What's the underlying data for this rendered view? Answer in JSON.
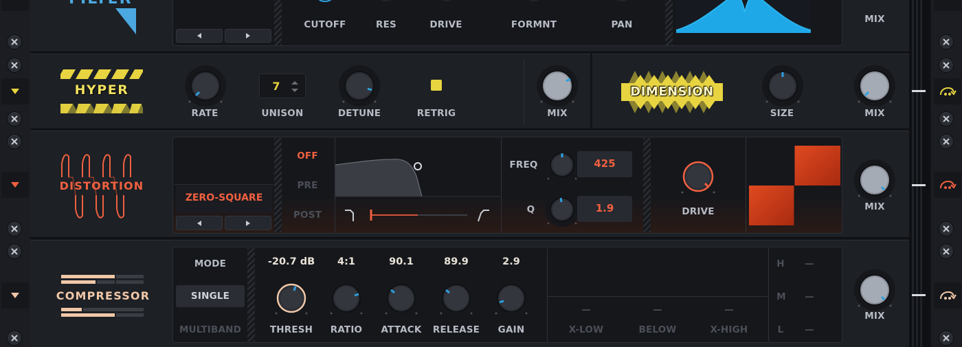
{
  "filter": {
    "title": "FILTER",
    "knob_labels": [
      "CUTOFF",
      "RES",
      "DRIVE",
      "FORMNT",
      "PAN"
    ],
    "mix_label": "MIX"
  },
  "hyper": {
    "logo": "HYPER",
    "rate_label": "RATE",
    "unison_label": "UNISON",
    "unison_value": "7",
    "detune_label": "DETUNE",
    "retrig_label": "RETRIG",
    "mix_label": "MIX",
    "accent": "#e8d440"
  },
  "dimension": {
    "logo": "DIMENSION",
    "size_label": "SIZE",
    "mix_label": "MIX"
  },
  "distortion": {
    "logo": "DISTORTION",
    "type": "ZERO-SQUARE",
    "filter_modes": [
      "OFF",
      "PRE",
      "POST"
    ],
    "freq_label": "FREQ",
    "freq_value": "425",
    "q_label": "Q",
    "q_value": "1.9",
    "drive_label": "DRIVE",
    "mix_label": "MIX",
    "accent": "#f06040"
  },
  "compressor": {
    "logo": "COMPRESSOR",
    "mode_label": "MODE",
    "modes": [
      "SINGLE",
      "MULTIBAND"
    ],
    "values": [
      "-20.7 dB",
      "4:1",
      "90.1",
      "89.9",
      "2.9"
    ],
    "knob_labels": [
      "THRESH",
      "RATIO",
      "ATTACK",
      "RELEASE",
      "GAIN"
    ],
    "band_labels": [
      "X-LOW",
      "BELOW",
      "X-HIGH"
    ],
    "band_values": [
      "—",
      "—",
      "—"
    ],
    "meter_labels": [
      "H",
      "M",
      "L"
    ],
    "meter_values": [
      "—",
      "—",
      "—"
    ],
    "mix_label": "MIX",
    "accent": "#f0c8a8"
  }
}
